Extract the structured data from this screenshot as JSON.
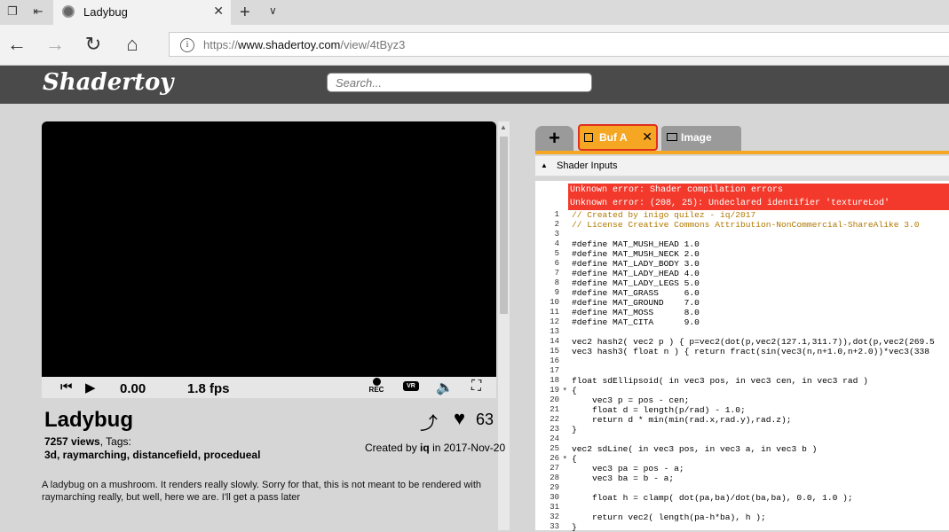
{
  "browser": {
    "tab_title": "Ladybug",
    "url_prefix": "https://",
    "url_domain": "www.shadertoy.com",
    "url_path": "/view/4tByz3"
  },
  "site": {
    "logo": "Shadertoy",
    "search_placeholder": "Search..."
  },
  "player": {
    "time": "0.00",
    "fps": "1.8 fps",
    "rec_label": "REC",
    "vr_label": "VR"
  },
  "shader": {
    "title": "Ladybug",
    "likes": "63",
    "views": "7257 views",
    "tags_label": ", Tags:",
    "tags": "3d, raymarching, distancefield, procedueal",
    "created_prefix": "Created by",
    "author": "iq",
    "created_suffix": "in 2017-Nov-20",
    "description": "A ladybug on a mushroom. It renders really slowly. Sorry for that, this is not meant to be rendered with raymarching really, but well, here we are. I'll get a pass later"
  },
  "editor": {
    "tabs": {
      "add": "+",
      "buf_a": "Buf A",
      "image": "Image"
    },
    "inputs_label": "Shader Inputs",
    "errors": [
      "Unknown error: Shader compilation errors",
      "Unknown error: (208, 25): Undeclared identifier 'textureLod'"
    ],
    "line_numbers": [
      "1",
      "2",
      "3",
      "4",
      "5",
      "6",
      "7",
      "8",
      "9",
      "10",
      "11",
      "12",
      "13",
      "14",
      "15",
      "16",
      "17",
      "18",
      "19",
      "20",
      "21",
      "22",
      "23",
      "24",
      "25",
      "26",
      "27",
      "28",
      "29",
      "30",
      "31",
      "32",
      "33"
    ],
    "code_lines": [
      "// Created by inigo quilez - iq/2017",
      "// License Creative Commons Attribution-NonCommercial-ShareAlike 3.0",
      "",
      "#define MAT_MUSH_HEAD 1.0",
      "#define MAT_MUSH_NECK 2.0",
      "#define MAT_LADY_BODY 3.0",
      "#define MAT_LADY_HEAD 4.0",
      "#define MAT_LADY_LEGS 5.0",
      "#define MAT_GRASS     6.0",
      "#define MAT_GROUND    7.0",
      "#define MAT_MOSS      8.0",
      "#define MAT_CITA      9.0",
      "",
      "vec2 hash2( vec2 p ) { p=vec2(dot(p,vec2(127.1,311.7)),dot(p,vec2(269.5",
      "vec3 hash3( float n ) { return fract(sin(vec3(n,n+1.0,n+2.0))*vec3(338",
      "",
      "",
      "float sdEllipsoid( in vec3 pos, in vec3 cen, in vec3 rad )",
      "{",
      "    vec3 p = pos - cen;",
      "    float d = length(p/rad) - 1.0;",
      "    return d * min(min(rad.x,rad.y),rad.z);",
      "}",
      "",
      "vec2 sdLine( in vec3 pos, in vec3 a, in vec3 b )",
      "{",
      "    vec3 pa = pos - a;",
      "    vec3 ba = b - a;",
      "",
      "    float h = clamp( dot(pa,ba)/dot(ba,ba), 0.0, 1.0 );",
      "",
      "    return vec2( length(pa-h*ba), h );",
      "}"
    ]
  }
}
